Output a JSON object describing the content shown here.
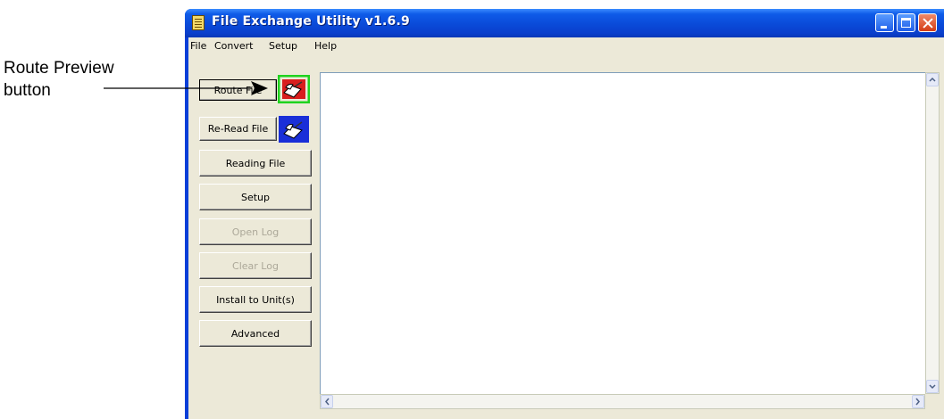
{
  "annotation": {
    "label_line1": "Route Preview",
    "label_line2": "button"
  },
  "window": {
    "title": "File Exchange Utility v1.6.9",
    "menu": [
      {
        "label": "File"
      },
      {
        "label": "Convert"
      },
      {
        "label": "Setup"
      },
      {
        "label": "Help"
      }
    ]
  },
  "sidebar": {
    "buttons": [
      {
        "label": "Route File",
        "enabled": true
      },
      {
        "label": "Re-Read File",
        "enabled": true
      },
      {
        "label": "Reading File",
        "enabled": true
      },
      {
        "label": "Setup",
        "enabled": true
      },
      {
        "label": "Open Log",
        "enabled": false
      },
      {
        "label": "Clear Log",
        "enabled": false
      },
      {
        "label": "Install to Unit(s)",
        "enabled": true
      },
      {
        "label": "Advanced",
        "enabled": true
      }
    ],
    "route_preview_icon": "route-preview-icon",
    "reread_preview_icon": "reread-preview-icon"
  },
  "colors": {
    "highlight": "#1fd31f",
    "titlebar": "#0a4ad8",
    "route_icon_bg": "#d81e1e",
    "reread_icon_bg": "#1a2fd8"
  }
}
